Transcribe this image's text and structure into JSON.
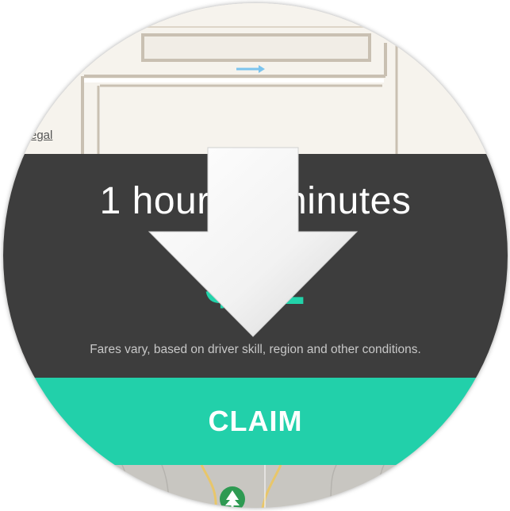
{
  "ride": {
    "duration_text": "1 hour 22 minutes",
    "fare_text": "$22",
    "fare_note": "Fares vary, based on driver skill, region and other conditions.",
    "claim_label": "CLAIM"
  },
  "map": {
    "street_label": "egal"
  },
  "colors": {
    "panel": "#3d3d3d",
    "accent": "#22d0aa",
    "pin": "#f4502f",
    "route_arrow": "#7cc4ee"
  },
  "icons": {
    "pin": "location-pin-icon",
    "overlay_arrow": "down-arrow-icon",
    "route": "direction-arrow-icon",
    "park": "tree-icon"
  }
}
